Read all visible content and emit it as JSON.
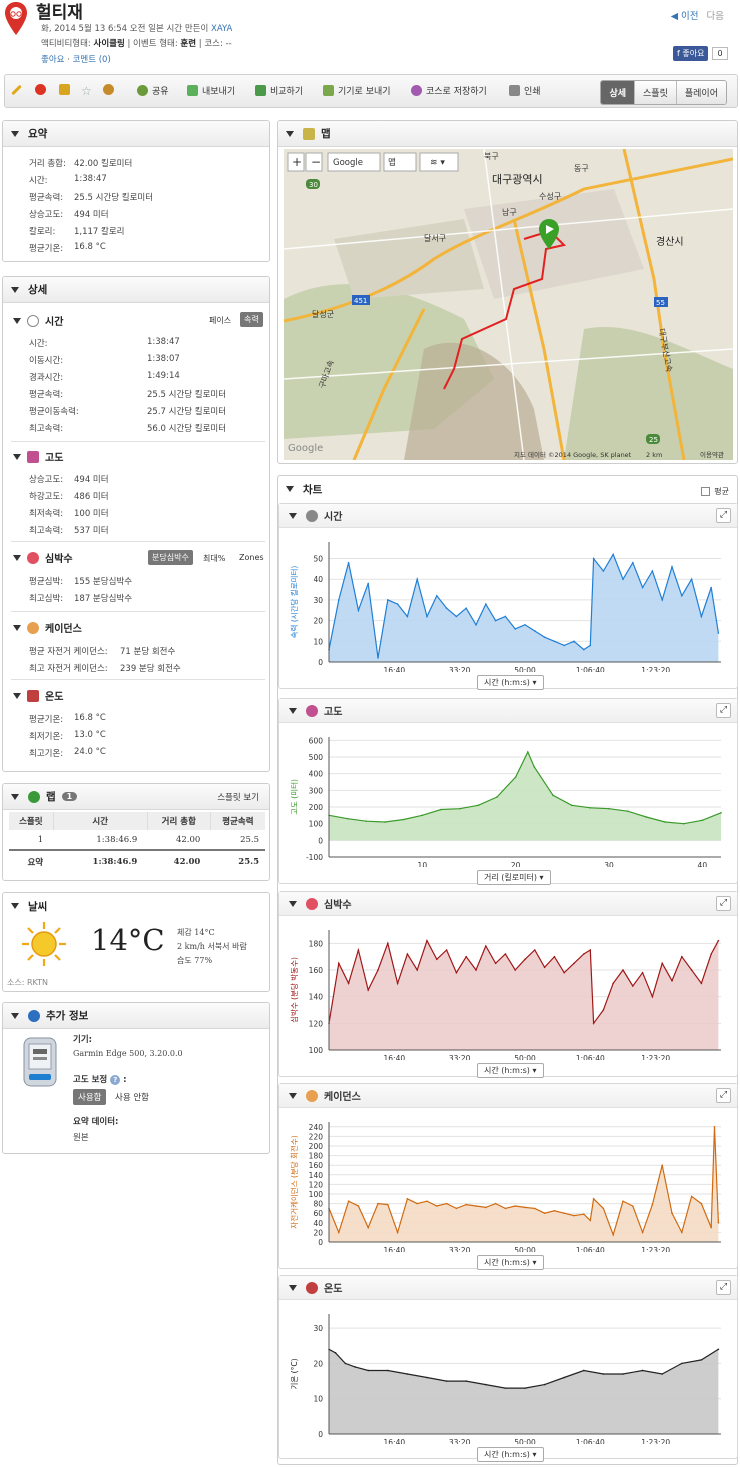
{
  "header": {
    "title": "헐티재",
    "line1_prefix": "화, 2014 5월 13 6:54 오전 일본 시간 만든이",
    "author": "XAYA",
    "line2_a": "액티비티형태:",
    "line2_b": "사이클링",
    "line2_c": "| 이벤트 형태:",
    "line2_d": "훈련",
    "line2_e": "| 코스: --",
    "like": "좋아요",
    "comment": "코멘트 (0)",
    "prev": "◀ 이전",
    "next": "다음",
    "fb_like": "f 좋아요",
    "fb_count": "0"
  },
  "toolbar": {
    "share": "공유",
    "export": "내보내기",
    "compare": "비교하기",
    "send_device": "기기로 보내기",
    "save_course": "코스로 저장하기",
    "print": "인쇄",
    "tabs": [
      "상세",
      "스플릿",
      "플레이어"
    ]
  },
  "summary": {
    "title": "요약",
    "rows": [
      {
        "k": "거리 총합:",
        "v": "42.00 킬로미터"
      },
      {
        "k": "시간:",
        "v": "1:38:47"
      },
      {
        "k": "평균속력:",
        "v": "25.5 시간당 킬로미터"
      },
      {
        "k": "상승고도:",
        "v": "494 미터"
      },
      {
        "k": "칼로리:",
        "v": "1,117 칼로리"
      },
      {
        "k": "평균기온:",
        "v": "16.8 °C"
      }
    ]
  },
  "detail": {
    "title": "상세",
    "time": {
      "title": "시간",
      "pace": "페이스",
      "speed": "속력",
      "rows": [
        {
          "k": "시간:",
          "v": "1:38:47"
        },
        {
          "k": "이동시간:",
          "v": "1:38:07"
        },
        {
          "k": "경과시간:",
          "v": "1:49:14"
        },
        {
          "k": "평균속력:",
          "v": "25.5 시간당 킬로미터"
        },
        {
          "k": "평균이동속력:",
          "v": "25.7 시간당 킬로미터"
        },
        {
          "k": "최고속력:",
          "v": "56.0 시간당 킬로미터"
        }
      ]
    },
    "elev": {
      "title": "고도",
      "rows": [
        {
          "k": "상승고도:",
          "v": "494 미터"
        },
        {
          "k": "하강고도:",
          "v": "486 미터"
        },
        {
          "k": "최저속력:",
          "v": "100 미터"
        },
        {
          "k": "최고속력:",
          "v": "537 미터"
        }
      ]
    },
    "hr": {
      "title": "심박수",
      "opt1": "분당심박수",
      "opt2": "최대%",
      "opt3": "Zones",
      "rows": [
        {
          "k": "평균심박:",
          "v": "155 분당심박수"
        },
        {
          "k": "최고심박:",
          "v": "187 분당심박수"
        }
      ]
    },
    "cad": {
      "title": "케이던스",
      "rows": [
        {
          "k": "평균 자전거 케이던스:",
          "v": "71 분당 회전수"
        },
        {
          "k": "최고 자전거 케이던스:",
          "v": "239 분당 회전수"
        }
      ]
    },
    "temp": {
      "title": "온도",
      "rows": [
        {
          "k": "평균기온:",
          "v": "16.8 °C"
        },
        {
          "k": "최저기온:",
          "v": "13.0 °C"
        },
        {
          "k": "최고기온:",
          "v": "24.0 °C"
        }
      ]
    }
  },
  "laps": {
    "title": "랩",
    "count": "1",
    "view_splits": "스플릿 보기",
    "headers": [
      "스플릿",
      "시간",
      "거리 총합",
      "평균속력"
    ],
    "row": [
      "1",
      "1:38:46.9",
      "42.00",
      "25.5"
    ],
    "summary": [
      "요약",
      "1:38:46.9",
      "42.00",
      "25.5"
    ]
  },
  "weather": {
    "title": "날씨",
    "temp": "14°C",
    "feels": "체감 14°C",
    "wind": "2 km/h 서북서 바람",
    "humidity": "습도 77%",
    "source": "소스: RKTN"
  },
  "more": {
    "title": "추가 정보",
    "device_label": "기기:",
    "device": "Garmin Edge 500, 3.20.0.0",
    "elev_corr": "고도 보정",
    "on": "사용함",
    "off": "사용 안함",
    "summary_data": "요약 데이터:",
    "original": "원본"
  },
  "map": {
    "title": "맵",
    "google": "Google",
    "maptype": "맵",
    "city": "대구광역시",
    "city2": "경산시",
    "labels": [
      "북구",
      "동구",
      "수성구",
      "남구",
      "달서구",
      "달성군",
      "구마고속",
      "대구부산고속",
      "451",
      "30",
      "55",
      "25"
    ],
    "copyright": "지도 데이터 ©2014 Google, SK planet",
    "scale": "2 km",
    "terms": "이용약관"
  },
  "charts": {
    "title": "차트",
    "avg": "평균",
    "colors": {
      "speed": "#1f7fd6",
      "elev": "#3a9a2a",
      "hr": "#a01818",
      "cad": "#d06a10",
      "temp": "#222222"
    },
    "time_axis": "시간 (h:m:s)",
    "dist_axis": "거리 (킬로미터)",
    "x_time_ticks": [
      "16:40",
      "33:20",
      "50:00",
      "1:06:40",
      "1:23:20"
    ],
    "x_dist_ticks": [
      "10",
      "20",
      "30",
      "40"
    ]
  },
  "chart_data": [
    {
      "type": "area",
      "title": "시간",
      "ylabel": "속력 (시간당 킬로미터)",
      "xlabel": "시간 (h:m:s)",
      "xlim": [
        0,
        6000
      ],
      "ylim": [
        0,
        58
      ],
      "yticks": [
        0,
        10,
        20,
        30,
        40,
        50
      ],
      "x": [
        0,
        150,
        300,
        450,
        600,
        750,
        900,
        1050,
        1200,
        1350,
        1500,
        1650,
        1800,
        1950,
        2100,
        2250,
        2400,
        2550,
        2700,
        2850,
        3000,
        3150,
        3300,
        3450,
        3600,
        3750,
        3900,
        4000,
        4050,
        4200,
        4350,
        4500,
        4650,
        4800,
        4950,
        5100,
        5250,
        5400,
        5550,
        5700,
        5850,
        5960
      ],
      "y": [
        6,
        30,
        48,
        25,
        38,
        2,
        30,
        28,
        22,
        40,
        22,
        32,
        26,
        22,
        26,
        18,
        28,
        20,
        22,
        16,
        18,
        15,
        12,
        10,
        8,
        10,
        6,
        8,
        50,
        44,
        52,
        40,
        48,
        36,
        44,
        30,
        46,
        32,
        40,
        22,
        36,
        14
      ]
    },
    {
      "type": "area",
      "title": "고도",
      "ylabel": "고도 (미터)",
      "xlabel": "거리 (킬로미터)",
      "xlim": [
        0,
        42
      ],
      "ylim": [
        -100,
        620
      ],
      "yticks": [
        -100,
        0,
        100,
        200,
        300,
        400,
        500,
        600
      ],
      "x": [
        0,
        2,
        4,
        6,
        8,
        10,
        12,
        14,
        16,
        18,
        20,
        21.3,
        22,
        24,
        26,
        28,
        30,
        32,
        34,
        36,
        38,
        40,
        42
      ],
      "y": [
        150,
        130,
        115,
        110,
        125,
        150,
        185,
        190,
        210,
        260,
        380,
        530,
        440,
        270,
        210,
        195,
        190,
        175,
        140,
        110,
        100,
        120,
        165
      ]
    },
    {
      "type": "line",
      "title": "심박수",
      "ylabel": "심박수 (분당 박동수)",
      "xlabel": "시간 (h:m:s)",
      "xlim": [
        0,
        6000
      ],
      "ylim": [
        100,
        190
      ],
      "yticks": [
        100,
        120,
        140,
        160,
        180
      ],
      "x": [
        0,
        150,
        300,
        450,
        600,
        750,
        900,
        1050,
        1200,
        1350,
        1500,
        1650,
        1800,
        1950,
        2100,
        2250,
        2400,
        2550,
        2700,
        2850,
        3000,
        3150,
        3300,
        3450,
        3600,
        3750,
        3900,
        4000,
        4050,
        4200,
        4350,
        4500,
        4650,
        4800,
        4950,
        5100,
        5250,
        5400,
        5550,
        5700,
        5850,
        5960
      ],
      "y": [
        120,
        165,
        150,
        175,
        145,
        160,
        180,
        150,
        172,
        160,
        182,
        168,
        175,
        158,
        170,
        160,
        178,
        165,
        172,
        160,
        168,
        175,
        162,
        170,
        158,
        165,
        172,
        175,
        120,
        130,
        150,
        160,
        148,
        158,
        140,
        165,
        152,
        170,
        160,
        150,
        172,
        182
      ]
    },
    {
      "type": "line",
      "title": "케이던스",
      "ylabel": "자전거케이던스 (분당 회전수)",
      "xlabel": "시간 (h:m:s)",
      "xlim": [
        0,
        6000
      ],
      "ylim": [
        0,
        250
      ],
      "yticks": [
        0,
        20,
        40,
        60,
        80,
        100,
        120,
        140,
        160,
        180,
        200,
        220,
        240
      ],
      "x": [
        0,
        150,
        300,
        450,
        600,
        750,
        900,
        1050,
        1200,
        1350,
        1500,
        1650,
        1800,
        1950,
        2100,
        2250,
        2400,
        2550,
        2700,
        2850,
        3000,
        3150,
        3300,
        3450,
        3600,
        3750,
        3900,
        4000,
        4050,
        4200,
        4350,
        4500,
        4650,
        4800,
        4950,
        5100,
        5250,
        5400,
        5550,
        5700,
        5850,
        5900,
        5960
      ],
      "y": [
        70,
        20,
        85,
        75,
        30,
        80,
        78,
        20,
        90,
        80,
        85,
        75,
        80,
        70,
        78,
        75,
        72,
        80,
        70,
        75,
        72,
        70,
        60,
        65,
        60,
        55,
        58,
        45,
        90,
        70,
        15,
        85,
        75,
        20,
        78,
        160,
        60,
        20,
        95,
        80,
        30,
        240,
        40
      ]
    },
    {
      "type": "area",
      "title": "온도",
      "ylabel": "기온 (°C)",
      "xlabel": "시간 (h:m:s)",
      "xlim": [
        0,
        6000
      ],
      "ylim": [
        0,
        34
      ],
      "yticks": [
        0,
        10,
        20,
        30
      ],
      "x": [
        0,
        100,
        250,
        400,
        600,
        900,
        1200,
        1500,
        1800,
        2100,
        2400,
        2700,
        3000,
        3300,
        3600,
        3900,
        4200,
        4500,
        4800,
        5100,
        5400,
        5700,
        5960
      ],
      "y": [
        24,
        23,
        20,
        19,
        18,
        18,
        17,
        16,
        15,
        15,
        14,
        13,
        13,
        14,
        16,
        18,
        17,
        17,
        18,
        17,
        20,
        21,
        24
      ]
    }
  ]
}
